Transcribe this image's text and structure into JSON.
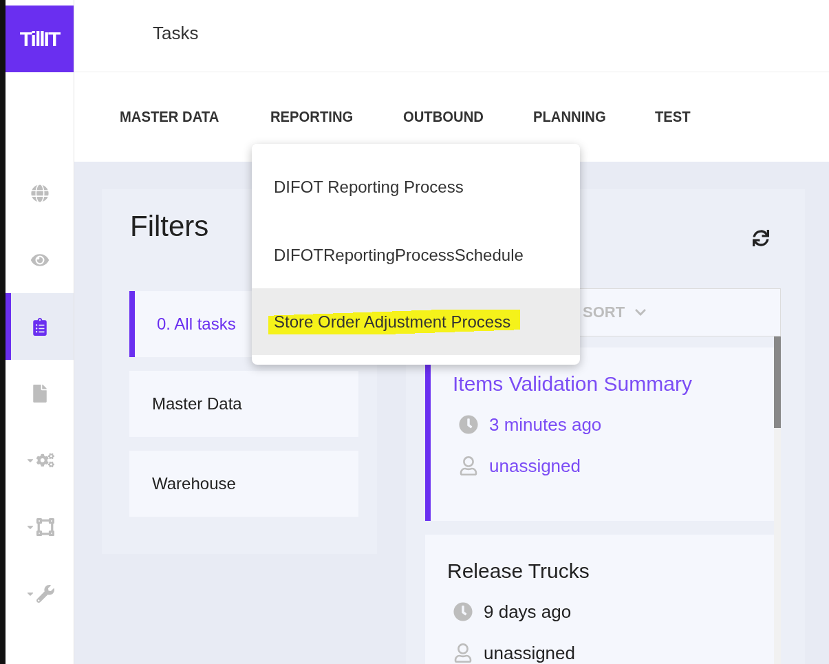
{
  "logo": {
    "text": "TillIT"
  },
  "sidebar": {
    "items": [
      {
        "selected": false,
        "expandable": false
      },
      {
        "selected": false,
        "expandable": false
      },
      {
        "selected": true,
        "expandable": false
      },
      {
        "selected": false,
        "expandable": false
      },
      {
        "selected": false,
        "expandable": true
      },
      {
        "selected": false,
        "expandable": true
      },
      {
        "selected": false,
        "expandable": true
      }
    ]
  },
  "header": {
    "title": "Tasks"
  },
  "tabs": [
    {
      "label": "MASTER DATA"
    },
    {
      "label": "REPORTING"
    },
    {
      "label": "OUTBOUND"
    },
    {
      "label": "PLANNING"
    },
    {
      "label": "TEST"
    }
  ],
  "menu": {
    "items": [
      {
        "label": "DIFOT Reporting Process",
        "hovered": false,
        "highlighted": false
      },
      {
        "label": "DIFOTReportingProcessSchedule",
        "hovered": false,
        "highlighted": false
      },
      {
        "label": "Store Order Adjustment Process",
        "hovered": true,
        "highlighted": true
      }
    ]
  },
  "filters": {
    "title": "Filters",
    "items": [
      {
        "label": "0. All tasks",
        "selected": true
      },
      {
        "label": "Master Data",
        "selected": false
      },
      {
        "label": "Warehouse",
        "selected": false
      }
    ]
  },
  "sort": {
    "label": "SORT"
  },
  "tasks": [
    {
      "title": "Items Validation Summary",
      "time": "3 minutes ago",
      "assignee": "unassigned",
      "selected": true
    },
    {
      "title": "Release Trucks",
      "time": "9 days ago",
      "assignee": "unassigned",
      "selected": false
    }
  ]
}
